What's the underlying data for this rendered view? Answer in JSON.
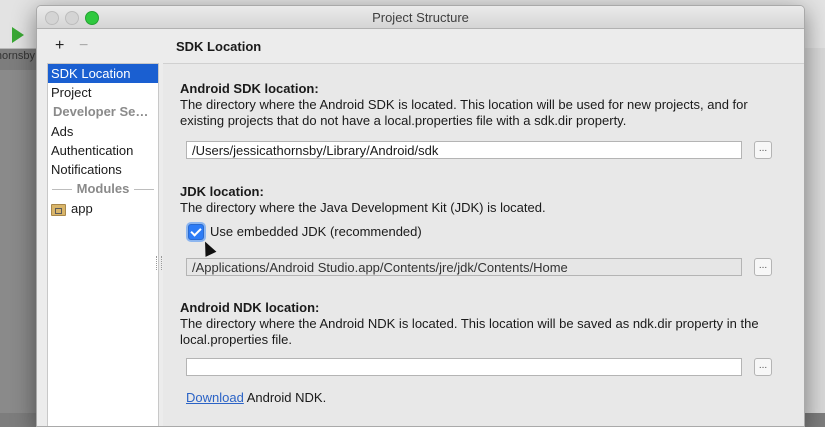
{
  "window": {
    "title": "Project Structure"
  },
  "background": {
    "tab_label": "jessicathornsby"
  },
  "nav": {
    "add_label": "+",
    "remove_label": "−",
    "items": [
      {
        "label": "SDK Location",
        "selected": true
      },
      {
        "label": "Project"
      }
    ],
    "developer_services_header": "Developer Se…",
    "developer_items": [
      "Ads",
      "Authentication",
      "Notifications"
    ],
    "modules_header": "Modules",
    "modules": [
      "app"
    ]
  },
  "content": {
    "section_title": "SDK Location",
    "sdk": {
      "label": "Android SDK location:",
      "description": "The directory where the Android SDK is located. This location will be used for new projects, and for existing projects that do not have a local.properties file with a sdk.dir property.",
      "path": "/Users/jessicathornsby/Library/Android/sdk",
      "browse_label": "..."
    },
    "jdk": {
      "label": "JDK location:",
      "description": "The directory where the Java Development Kit (JDK) is located.",
      "checkbox_label": "Use embedded JDK (recommended)",
      "checkbox_checked": true,
      "path": "/Applications/Android Studio.app/Contents/jre/jdk/Contents/Home",
      "browse_label": "..."
    },
    "ndk": {
      "label": "Android NDK location:",
      "description": "The directory where the Android NDK is located. This location will be saved as ndk.dir property in the local.properties file.",
      "path": "",
      "browse_label": "...",
      "download_link": "Download",
      "download_suffix": " Android NDK."
    }
  },
  "colors": {
    "selection": "#1a5fd1",
    "link": "#2b63c6",
    "checkbox": "#2d7cf6",
    "run_icon": "#3aa835"
  }
}
